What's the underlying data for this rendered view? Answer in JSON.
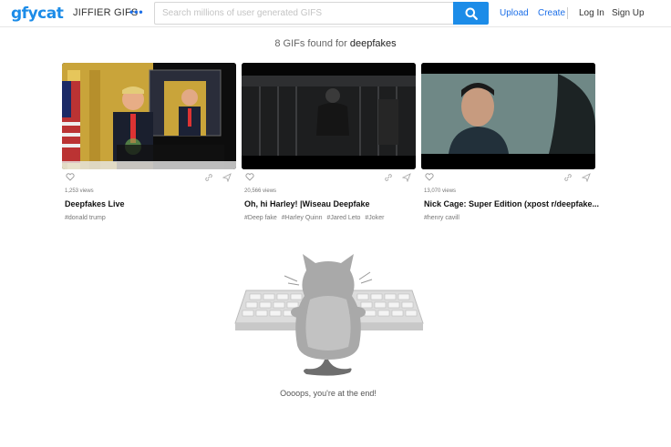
{
  "header": {
    "logo": "gfycat",
    "tagline": "JIFFIER GIFS",
    "more": "•••",
    "search_placeholder": "Search millions of user generated GIFS",
    "upload": "Upload",
    "create": "Create",
    "login": "Log In",
    "signup": "Sign Up"
  },
  "results": {
    "prefix": "8 GIFs found for",
    "query": "deepfakes"
  },
  "cards": [
    {
      "views": "1,253 views",
      "title": "Deepfakes Live",
      "tags": [
        "#donald trump"
      ]
    },
    {
      "views": "20,566 views",
      "title": "Oh, hi Harley! |Wiseau Deepfake",
      "tags": [
        "#Deep fake",
        "#Harley Quinn",
        "#Jared Leto",
        "#Joker"
      ]
    },
    {
      "views": "13,070 views",
      "title": "Nick Cage: Super Edition (xpost r/deepfake...",
      "tags": [
        "#henry cavill"
      ]
    }
  ],
  "end": {
    "message": "Oooops, you're at the end!"
  },
  "colors": {
    "brand": "#1c8ce8",
    "link": "#1c6fe8"
  }
}
